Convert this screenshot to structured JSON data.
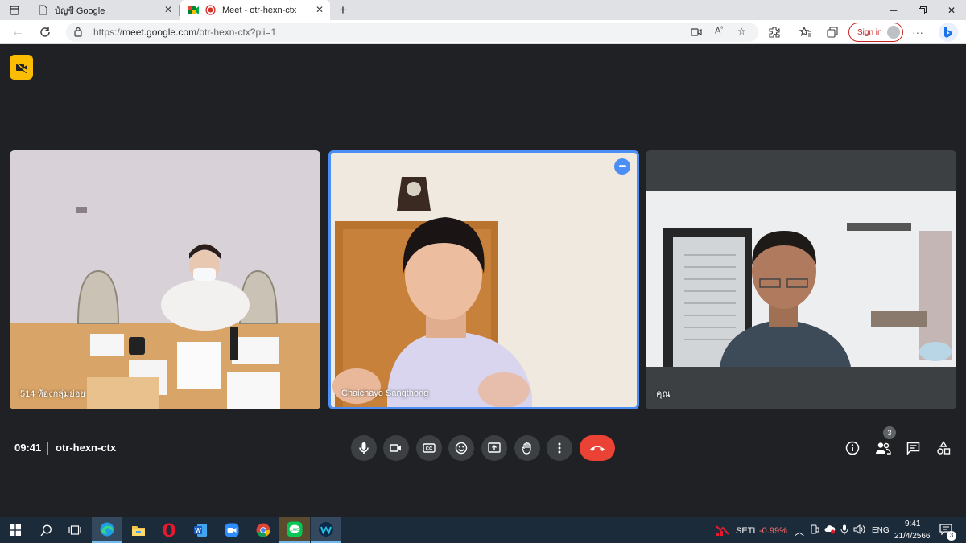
{
  "browser": {
    "tabs": [
      {
        "title": "บัญชี Google",
        "icon": "document-icon"
      },
      {
        "title": "Meet - otr-hexn-ctx",
        "icon": "google-meet-icon",
        "active": true
      }
    ],
    "url_prefix": "https://",
    "url_host": "meet.google.com",
    "url_path": "/otr-hexn-ctx?pli=1",
    "sign_in_label": "Sign in"
  },
  "meet": {
    "tiles": [
      {
        "name": "514 ห้องกลุ่มย่อย"
      },
      {
        "name": "Chaichayo Sangthong",
        "active_speaker": true
      },
      {
        "name": "คุณ"
      }
    ],
    "clock": "09:41",
    "meeting_code": "otr-hexn-ctx",
    "participant_count": "3"
  },
  "taskbar": {
    "stock_name": "SETI",
    "stock_change": "-0.99%",
    "language": "ENG",
    "time": "9:41",
    "date": "21/4/2566",
    "notification_count": "3"
  },
  "colors": {
    "meet_bg": "#202124",
    "active_border": "#4b8ff6",
    "end_call": "#ea4335",
    "cam_off_badge": "#fbbc04",
    "stock_negative": "#ff6b6b"
  }
}
